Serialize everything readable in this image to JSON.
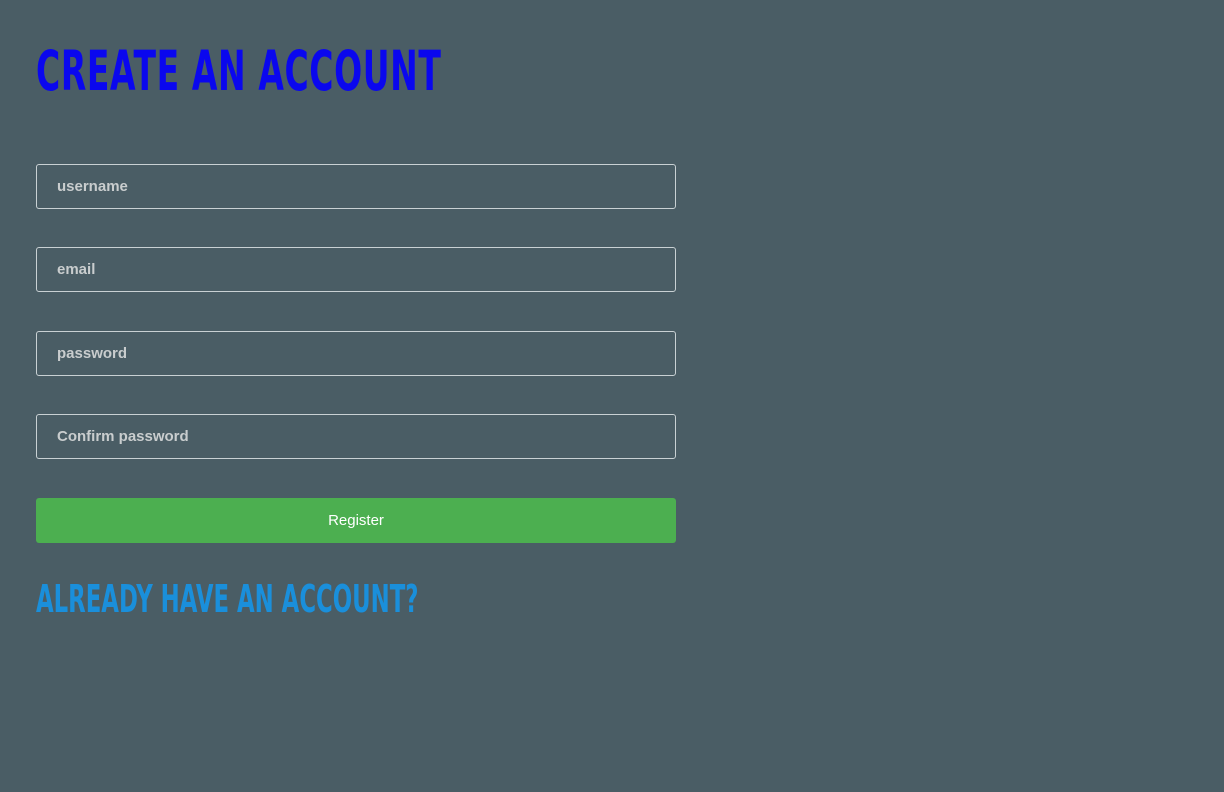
{
  "form": {
    "title": "Create an account",
    "fields": {
      "username": {
        "placeholder": "username",
        "value": ""
      },
      "email": {
        "placeholder": "email",
        "value": ""
      },
      "password": {
        "placeholder": "password",
        "value": ""
      },
      "confirm_password": {
        "placeholder": "Confirm password",
        "value": ""
      }
    },
    "register_label": "Register",
    "login_link_label": "Already have an account?"
  },
  "colors": {
    "background": "#4a5d65",
    "title": "#0a07ee",
    "link": "#1a8fdb",
    "button": "#4caf50",
    "field_border": "#c9d1d4"
  }
}
